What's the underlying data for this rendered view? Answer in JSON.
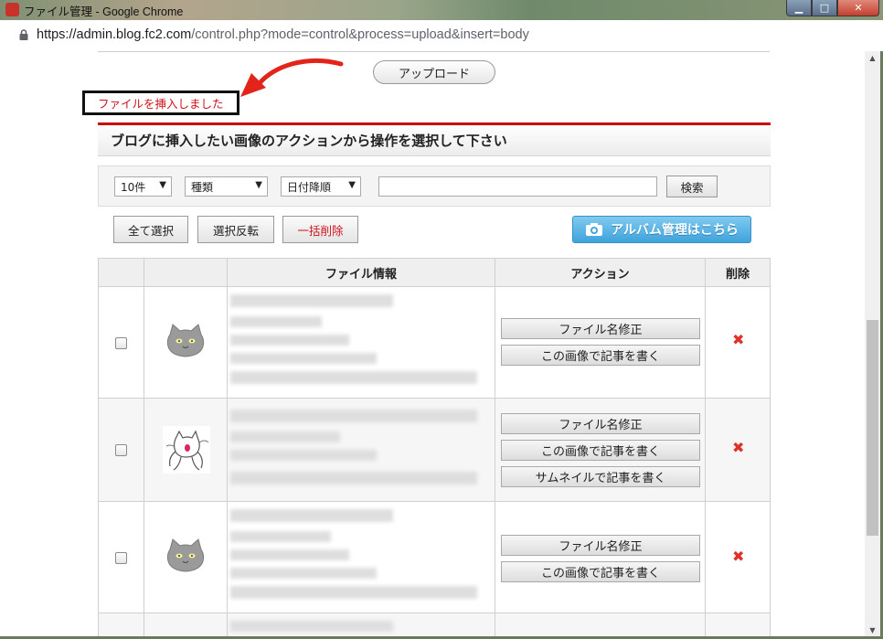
{
  "window": {
    "title": "ファイル管理 - Google Chrome",
    "min_glyph": "▁",
    "max_glyph": "□",
    "close_glyph": "✕"
  },
  "address": {
    "scheme_host": "https://admin.blog.fc2.com",
    "path": "/control.php?mode=control&process=upload&insert=body"
  },
  "upload_button": "アップロード",
  "notice": "ファイルを挿入しました",
  "section_title": "ブログに挿入したい画像のアクションから操作を選択して下さい",
  "filters": {
    "count": "10件",
    "type": "種類",
    "sort": "日付降順",
    "search_value": "",
    "search_button": "検索",
    "caret": "▼"
  },
  "toolbar": {
    "select_all": "全て選択",
    "invert": "選択反転",
    "bulk_delete": "一括削除",
    "album": "アルバム管理はこちら"
  },
  "table": {
    "headers": [
      "",
      "",
      "ファイル情報",
      "アクション",
      "削除"
    ],
    "rows": [
      {
        "thumb": "cat-face",
        "actions": [
          "ファイル名修正",
          "この画像で記事を書く"
        ]
      },
      {
        "thumb": "cat-drawing",
        "actions": [
          "ファイル名修正",
          "この画像で記事を書く",
          "サムネイルで記事を書く"
        ]
      },
      {
        "thumb": "cat-face",
        "actions": [
          "ファイル名修正",
          "この画像で記事を書く"
        ]
      }
    ],
    "delete_glyph": "✖"
  },
  "colors": {
    "accent_red": "#cc0000",
    "notice_red": "#d0121b",
    "album_blue": "#3fa3dc"
  }
}
